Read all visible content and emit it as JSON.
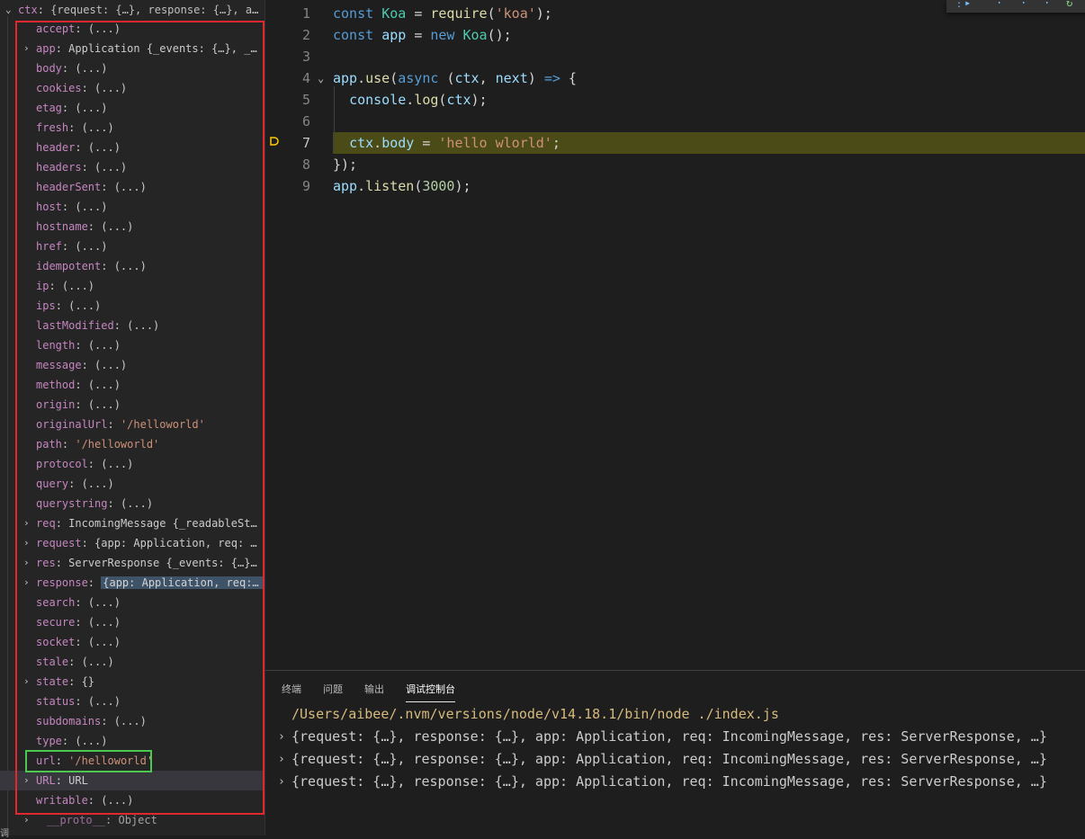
{
  "variables": {
    "ctx": {
      "key": "ctx",
      "value": "{request: {…}, response: {…}, app: …"
    },
    "items": [
      {
        "key": "accept",
        "value": "(...)",
        "expandable": false,
        "kind": "plain"
      },
      {
        "key": "app",
        "value": "Application {_events: {…}, _even…",
        "expandable": true,
        "kind": "obj"
      },
      {
        "key": "body",
        "value": "(...)",
        "expandable": false,
        "kind": "plain"
      },
      {
        "key": "cookies",
        "value": "(...)",
        "expandable": false,
        "kind": "plain"
      },
      {
        "key": "etag",
        "value": "(...)",
        "expandable": false,
        "kind": "plain"
      },
      {
        "key": "fresh",
        "value": "(...)",
        "expandable": false,
        "kind": "plain"
      },
      {
        "key": "header",
        "value": "(...)",
        "expandable": false,
        "kind": "plain"
      },
      {
        "key": "headers",
        "value": "(...)",
        "expandable": false,
        "kind": "plain"
      },
      {
        "key": "headerSent",
        "value": "(...)",
        "expandable": false,
        "kind": "plain"
      },
      {
        "key": "host",
        "value": "(...)",
        "expandable": false,
        "kind": "plain"
      },
      {
        "key": "hostname",
        "value": "(...)",
        "expandable": false,
        "kind": "plain"
      },
      {
        "key": "href",
        "value": "(...)",
        "expandable": false,
        "kind": "plain"
      },
      {
        "key": "idempotent",
        "value": "(...)",
        "expandable": false,
        "kind": "plain"
      },
      {
        "key": "ip",
        "value": "(...)",
        "expandable": false,
        "kind": "plain"
      },
      {
        "key": "ips",
        "value": "(...)",
        "expandable": false,
        "kind": "plain"
      },
      {
        "key": "lastModified",
        "value": "(...)",
        "expandable": false,
        "kind": "plain"
      },
      {
        "key": "length",
        "value": "(...)",
        "expandable": false,
        "kind": "plain"
      },
      {
        "key": "message",
        "value": "(...)",
        "expandable": false,
        "kind": "plain"
      },
      {
        "key": "method",
        "value": "(...)",
        "expandable": false,
        "kind": "plain"
      },
      {
        "key": "origin",
        "value": "(...)",
        "expandable": false,
        "kind": "plain"
      },
      {
        "key": "originalUrl",
        "value": "'/helloworld'",
        "expandable": false,
        "kind": "str"
      },
      {
        "key": "path",
        "value": "'/helloworld'",
        "expandable": false,
        "kind": "str"
      },
      {
        "key": "protocol",
        "value": "(...)",
        "expandable": false,
        "kind": "plain"
      },
      {
        "key": "query",
        "value": "(...)",
        "expandable": false,
        "kind": "plain"
      },
      {
        "key": "querystring",
        "value": "(...)",
        "expandable": false,
        "kind": "plain"
      },
      {
        "key": "req",
        "value": "IncomingMessage {_readableState:…",
        "expandable": true,
        "kind": "obj"
      },
      {
        "key": "request",
        "value": "{app: Application, req: Inco…",
        "expandable": true,
        "kind": "obj"
      },
      {
        "key": "res",
        "value": "ServerResponse {_events: {…}, _e…",
        "expandable": true,
        "kind": "obj"
      },
      {
        "key": "response",
        "value": "{app: Application, req: Inc…",
        "expandable": true,
        "kind": "obj-hl"
      },
      {
        "key": "search",
        "value": "(...)",
        "expandable": false,
        "kind": "plain"
      },
      {
        "key": "secure",
        "value": "(...)",
        "expandable": false,
        "kind": "plain"
      },
      {
        "key": "socket",
        "value": "(...)",
        "expandable": false,
        "kind": "plain"
      },
      {
        "key": "stale",
        "value": "(...)",
        "expandable": false,
        "kind": "plain"
      },
      {
        "key": "state",
        "value": "{}",
        "expandable": true,
        "kind": "obj"
      },
      {
        "key": "status",
        "value": "(...)",
        "expandable": false,
        "kind": "plain"
      },
      {
        "key": "subdomains",
        "value": "(...)",
        "expandable": false,
        "kind": "plain"
      },
      {
        "key": "type",
        "value": "(...)",
        "expandable": false,
        "kind": "plain"
      },
      {
        "key": "url",
        "value": "'/helloworld'",
        "expandable": false,
        "kind": "str"
      },
      {
        "key": "URL",
        "value": "URL",
        "expandable": true,
        "kind": "obj-hover"
      },
      {
        "key": "writable",
        "value": "(...)",
        "expandable": false,
        "kind": "plain"
      },
      {
        "key": "__proto__",
        "value": "Object",
        "expandable": true,
        "kind": "proto"
      }
    ]
  },
  "editor": {
    "lines": [
      {
        "n": "1",
        "html": "<span class='kw'>const</span> <span class='cls'>Koa</span> <span class='pn'>=</span> <span class='fn'>require</span><span class='pn'>(</span><span class='str2'>'koa'</span><span class='pn'>);</span>"
      },
      {
        "n": "2",
        "html": "<span class='kw'>const</span> <span class='var'>app</span> <span class='pn'>=</span> <span class='kw'>new</span> <span class='cls'>Koa</span><span class='pn'>();</span>"
      },
      {
        "n": "3",
        "html": ""
      },
      {
        "n": "4",
        "html": "<span class='var'>app</span><span class='pn'>.</span><span class='fn'>use</span><span class='pn'>(</span><span class='kw'>async</span> <span class='pn'>(</span><span class='var'>ctx</span><span class='pn'>,</span> <span class='var'>next</span><span class='pn'>)</span> <span class='kw'>=&gt;</span> <span class='pn'>{</span>"
      },
      {
        "n": "5",
        "html": "  <span class='var'>console</span><span class='pn'>.</span><span class='fn'>log</span><span class='pn'>(</span><span class='var'>ctx</span><span class='pn'>);</span>"
      },
      {
        "n": "6",
        "html": ""
      },
      {
        "n": "7",
        "html": "  <span class='var'>ctx</span><span class='pn'>.</span><span class='var'>body</span> <span class='pn'>=</span> <span class='str2'>'hello wlorld'</span><span class='pn'>;</span>"
      },
      {
        "n": "8",
        "html": "<span class='pn'>});</span>"
      },
      {
        "n": "9",
        "html": "<span class='var'>app</span><span class='pn'>.</span><span class='fn'>listen</span><span class='pn'>(</span><span class='num'>3000</span><span class='pn'>);</span>"
      }
    ],
    "current_line": "7"
  },
  "bottom_panel": {
    "tabs": [
      "终端",
      "问题",
      "输出",
      "调试控制台"
    ],
    "active_tab": "调试控制台",
    "output": [
      {
        "arrow": false,
        "text": "/Users/aibee/.nvm/versions/node/v14.18.1/bin/node ./index.js"
      },
      {
        "arrow": true,
        "text": "{request: {…}, response: {…}, app: Application, req: IncomingMessage, res: ServerResponse, …}"
      },
      {
        "arrow": true,
        "text": "{request: {…}, response: {…}, app: Application, req: IncomingMessage, res: ServerResponse, …}"
      },
      {
        "arrow": true,
        "text": "{request: {…}, response: {…}, app: Application, req: IncomingMessage, res: ServerResponse, …}"
      }
    ]
  },
  "corner_text": "调",
  "colors": {
    "highlight_box": "#e0282e",
    "url_box": "#4cc750",
    "current_line_bg": "#4b4b18"
  }
}
